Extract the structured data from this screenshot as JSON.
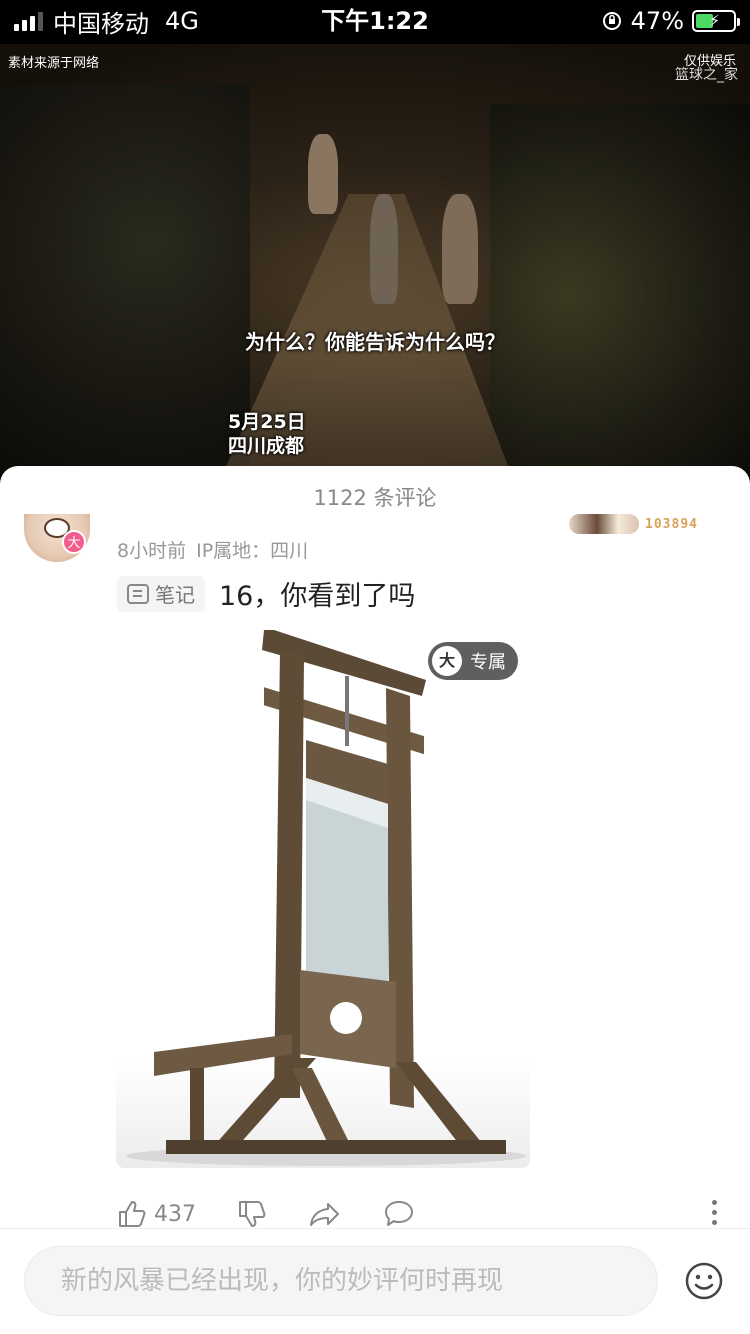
{
  "status_bar": {
    "carrier": "中国移动",
    "network": "4G",
    "time": "下午1:22",
    "battery": "47%",
    "battery_level": 0.47
  },
  "video": {
    "watermark_left": "素材来源于网络",
    "watermark_right_1": "仅供娱乐",
    "watermark_right_2": "篮球之_家",
    "subtitle": "为什么？你能告诉为什么吗？",
    "caption_date": "5月25日",
    "caption_place": "四川成都"
  },
  "comments": {
    "title": "1122 条评论",
    "item": {
      "avatar_badge": "大",
      "time": "8小时前",
      "ip_label": "IP属地：四川",
      "rank_number": "103894",
      "note_label": "笔记",
      "text": "16，你看到了吗",
      "exclusive_badge_icon": "大",
      "exclusive_badge_label": "专属",
      "like_count": "437"
    }
  },
  "input": {
    "placeholder": "新的风暴已经出现，你的妙评何时再现"
  },
  "colors": {
    "badge_pink": "#f25d8e",
    "battery_green": "#4cd964",
    "muted_text": "#999999"
  }
}
